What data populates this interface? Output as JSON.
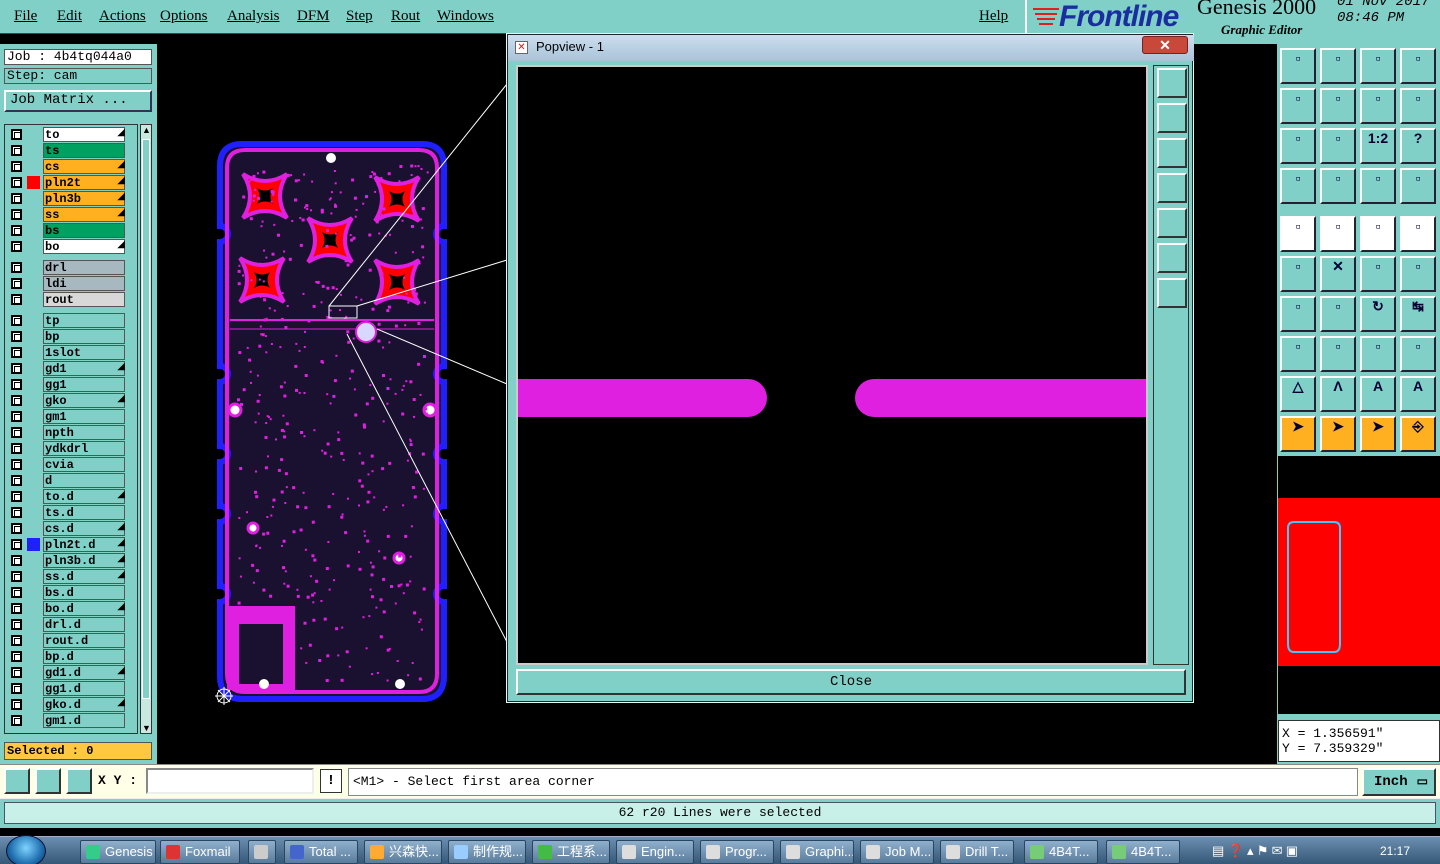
{
  "menubar": {
    "items": [
      "File",
      "Edit",
      "Actions",
      "Options",
      "Analysis",
      "DFM",
      "Step",
      "Rout",
      "Windows"
    ],
    "help": "Help"
  },
  "brand": {
    "logo": "Frontline",
    "product": "Genesis 2000",
    "subtitle": "Graphic Editor",
    "date": "01 Nov 2017",
    "time": "08:46 PM"
  },
  "job": {
    "job_label": "Job : 4b4tq044a0",
    "step_label": "Step: cam",
    "matrix_button": "Job Matrix ..."
  },
  "layers": [
    {
      "name": "to",
      "color": "#ffffff",
      "arrow": true,
      "swatch": ""
    },
    {
      "name": "ts",
      "color": "#00a060",
      "arrow": false,
      "swatch": ""
    },
    {
      "name": "cs",
      "color": "#ffb020",
      "arrow": true,
      "swatch": ""
    },
    {
      "name": "pln2t",
      "color": "#ffb020",
      "arrow": true,
      "swatch": "#ff0000"
    },
    {
      "name": "pln3b",
      "color": "#ffb020",
      "arrow": true,
      "swatch": ""
    },
    {
      "name": "ss",
      "color": "#ffb020",
      "arrow": true,
      "swatch": ""
    },
    {
      "name": "bs",
      "color": "#00a060",
      "arrow": false,
      "swatch": ""
    },
    {
      "name": "bo",
      "color": "#ffffff",
      "arrow": true,
      "swatch": ""
    },
    {
      "name": "drl",
      "color": "#a8b8c0",
      "arrow": false,
      "swatch": ""
    },
    {
      "name": "ldi",
      "color": "#a8b8c0",
      "arrow": false,
      "swatch": ""
    },
    {
      "name": "rout",
      "color": "#d8d8d8",
      "arrow": false,
      "swatch": ""
    },
    {
      "name": "tp",
      "color": "#80d0c8",
      "arrow": false,
      "swatch": ""
    },
    {
      "name": "bp",
      "color": "#80d0c8",
      "arrow": false,
      "swatch": ""
    },
    {
      "name": "1slot",
      "color": "#80d0c8",
      "arrow": false,
      "swatch": ""
    },
    {
      "name": "gd1",
      "color": "#80d0c8",
      "arrow": true,
      "swatch": ""
    },
    {
      "name": "gg1",
      "color": "#80d0c8",
      "arrow": false,
      "swatch": ""
    },
    {
      "name": "gko",
      "color": "#80d0c8",
      "arrow": true,
      "swatch": ""
    },
    {
      "name": "gm1",
      "color": "#80d0c8",
      "arrow": false,
      "swatch": ""
    },
    {
      "name": "npth",
      "color": "#80d0c8",
      "arrow": false,
      "swatch": ""
    },
    {
      "name": "ydkdrl",
      "color": "#80d0c8",
      "arrow": false,
      "swatch": ""
    },
    {
      "name": "cvia",
      "color": "#80d0c8",
      "arrow": false,
      "swatch": ""
    },
    {
      "name": "d",
      "color": "#80d0c8",
      "arrow": false,
      "swatch": ""
    },
    {
      "name": "to.d",
      "color": "#80d0c8",
      "arrow": true,
      "swatch": ""
    },
    {
      "name": "ts.d",
      "color": "#80d0c8",
      "arrow": false,
      "swatch": ""
    },
    {
      "name": "cs.d",
      "color": "#80d0c8",
      "arrow": true,
      "swatch": ""
    },
    {
      "name": "pln2t.d",
      "color": "#80d0c8",
      "arrow": true,
      "swatch": "#2020ff"
    },
    {
      "name": "pln3b.d",
      "color": "#80d0c8",
      "arrow": true,
      "swatch": ""
    },
    {
      "name": "ss.d",
      "color": "#80d0c8",
      "arrow": true,
      "swatch": ""
    },
    {
      "name": "bs.d",
      "color": "#80d0c8",
      "arrow": false,
      "swatch": ""
    },
    {
      "name": "bo.d",
      "color": "#80d0c8",
      "arrow": true,
      "swatch": ""
    },
    {
      "name": "drl.d",
      "color": "#80d0c8",
      "arrow": false,
      "swatch": ""
    },
    {
      "name": "rout.d",
      "color": "#80d0c8",
      "arrow": false,
      "swatch": ""
    },
    {
      "name": "bp.d",
      "color": "#80d0c8",
      "arrow": false,
      "swatch": ""
    },
    {
      "name": "gd1.d",
      "color": "#80d0c8",
      "arrow": true,
      "swatch": ""
    },
    {
      "name": "gg1.d",
      "color": "#80d0c8",
      "arrow": false,
      "swatch": ""
    },
    {
      "name": "gko.d",
      "color": "#80d0c8",
      "arrow": true,
      "swatch": ""
    },
    {
      "name": "gm1.d",
      "color": "#80d0c8",
      "arrow": false,
      "swatch": ""
    }
  ],
  "selected_label": "Selected : 0",
  "popview": {
    "title": "Popview - 1",
    "close_button": "Close"
  },
  "coords": {
    "x": "X = 1.356591\"",
    "y": "Y = 7.359329\""
  },
  "cmdbar": {
    "xy_label": "X Y :",
    "xy_value": "",
    "bang": "!",
    "prompt": "<M1> - Select first area corner",
    "units": "Inch"
  },
  "status_message": "62 r20 Lines were selected",
  "taskbar": {
    "items": [
      "Genesis",
      "Foxmail",
      "",
      "Total ...",
      "兴森快...",
      "制作规...",
      "工程系...",
      "Engin...",
      "Progr...",
      "Graphi...",
      "Job M...",
      "Drill T...",
      "4B4T...",
      "4B4T..."
    ],
    "clock": "21:17"
  },
  "colors": {
    "teal": "#80d0c8",
    "board_magenta": "#e020e0",
    "board_outline": "#2020ff",
    "pad_red": "#ff0000"
  }
}
